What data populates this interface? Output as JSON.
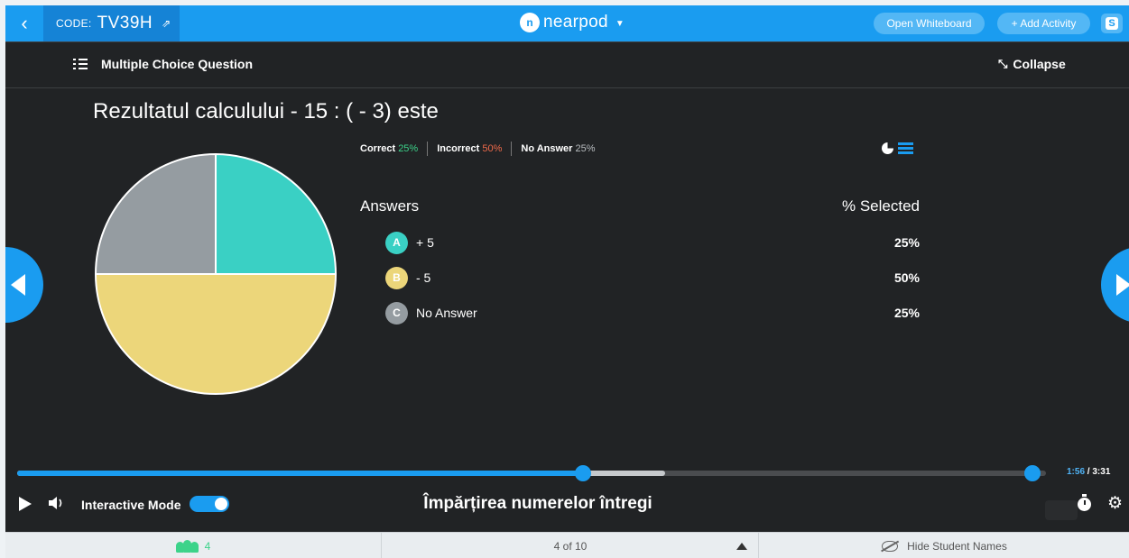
{
  "topbar": {
    "back_icon": "chevron-left-icon",
    "code_label": "CODE:",
    "code_value": "TV39H",
    "share_icon": "external-link-icon",
    "logo_text": "nearpod",
    "open_whiteboard": "Open Whiteboard",
    "add_activity": "+ Add Activity",
    "avatar_letter": "S"
  },
  "header": {
    "question_type": "Multiple Choice Question",
    "collapse_label": "Collapse"
  },
  "question": {
    "text": "Rezultatul calculului - 15 : ( - 3) este"
  },
  "stats": {
    "correct_label": "Correct",
    "correct_value": "25%",
    "incorrect_label": "Incorrect",
    "incorrect_value": "50%",
    "no_answer_label": "No Answer",
    "no_answer_value": "25%"
  },
  "colors": {
    "accent": "#1a9cf0",
    "option_a": "#3ad0c4",
    "option_b": "#ecd67a",
    "option_c": "#959ca1",
    "correct": "#3cd38a",
    "incorrect": "#f06a4a"
  },
  "answers": {
    "header_label": "Answers",
    "header_pct": "% Selected",
    "options": [
      {
        "letter": "A",
        "text": "+ 5",
        "percent": "25%",
        "color": "#3ad0c4"
      },
      {
        "letter": "B",
        "text": "- 5",
        "percent": "50%",
        "color": "#ecd67a"
      },
      {
        "letter": "C",
        "text": "No Answer",
        "percent": "25%",
        "color": "#959ca1"
      }
    ]
  },
  "chart_data": {
    "type": "pie",
    "categories": [
      "+ 5",
      "- 5",
      "No Answer"
    ],
    "values": [
      25,
      50,
      25
    ],
    "colors": [
      "#3ad0c4",
      "#ecd67a",
      "#959ca1"
    ]
  },
  "player": {
    "current_time": "1:56",
    "separator": "/",
    "total_time": "3:31",
    "played_fraction": 0.55,
    "buffered_fraction": 0.63,
    "end_marker_fraction": 0.987,
    "interactive_mode_label": "Interactive Mode",
    "interactive_mode_on": true,
    "lesson_title": "Împărțirea numerelor întregi"
  },
  "bottombar": {
    "student_count": "4",
    "page_indicator": "4 of 10",
    "hide_names": "Hide Student Names"
  }
}
